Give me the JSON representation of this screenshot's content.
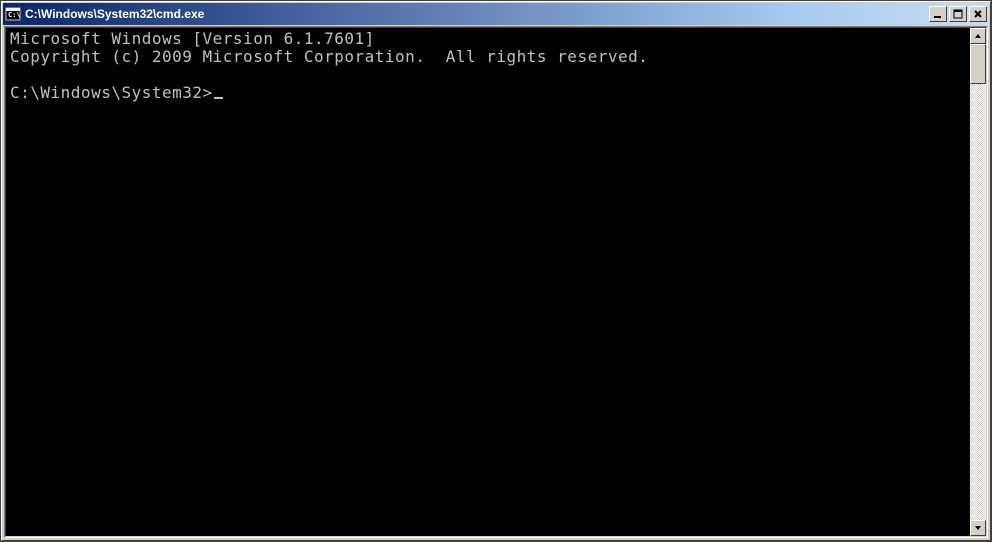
{
  "window": {
    "title": "C:\\Windows\\System32\\cmd.exe"
  },
  "console": {
    "line1": "Microsoft Windows [Version 6.1.7601]",
    "line2": "Copyright (c) 2009 Microsoft Corporation.  All rights reserved.",
    "blank": "",
    "prompt": "C:\\Windows\\System32>"
  }
}
